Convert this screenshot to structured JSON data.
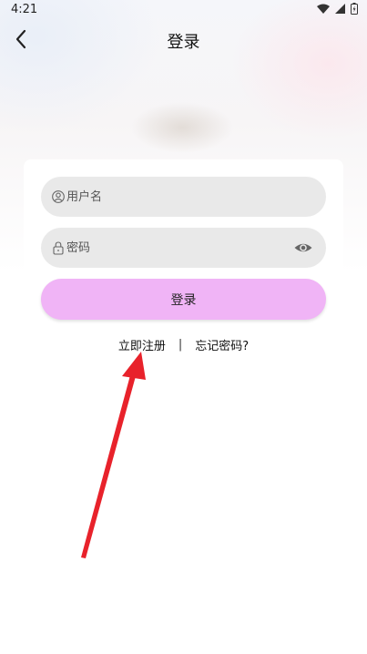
{
  "status_bar": {
    "time": "4:21",
    "icons": [
      "wifi-icon",
      "signal-icon",
      "battery-icon"
    ]
  },
  "nav": {
    "title": "登录",
    "back_icon": "chevron-left-icon"
  },
  "form": {
    "username": {
      "placeholder": "用户名",
      "value": "",
      "icon": "user-icon"
    },
    "password": {
      "placeholder": "密码",
      "value": "",
      "icon": "lock-icon",
      "visibility_icon": "eye-icon"
    },
    "login_button_label": "登录"
  },
  "links": {
    "register": "立即注册",
    "separator": "|",
    "forgot_password": "忘记密码?"
  },
  "colors": {
    "login_button": "#f0b4f6",
    "field_background": "#e9e9e9",
    "annotation_arrow": "#e8222b"
  }
}
